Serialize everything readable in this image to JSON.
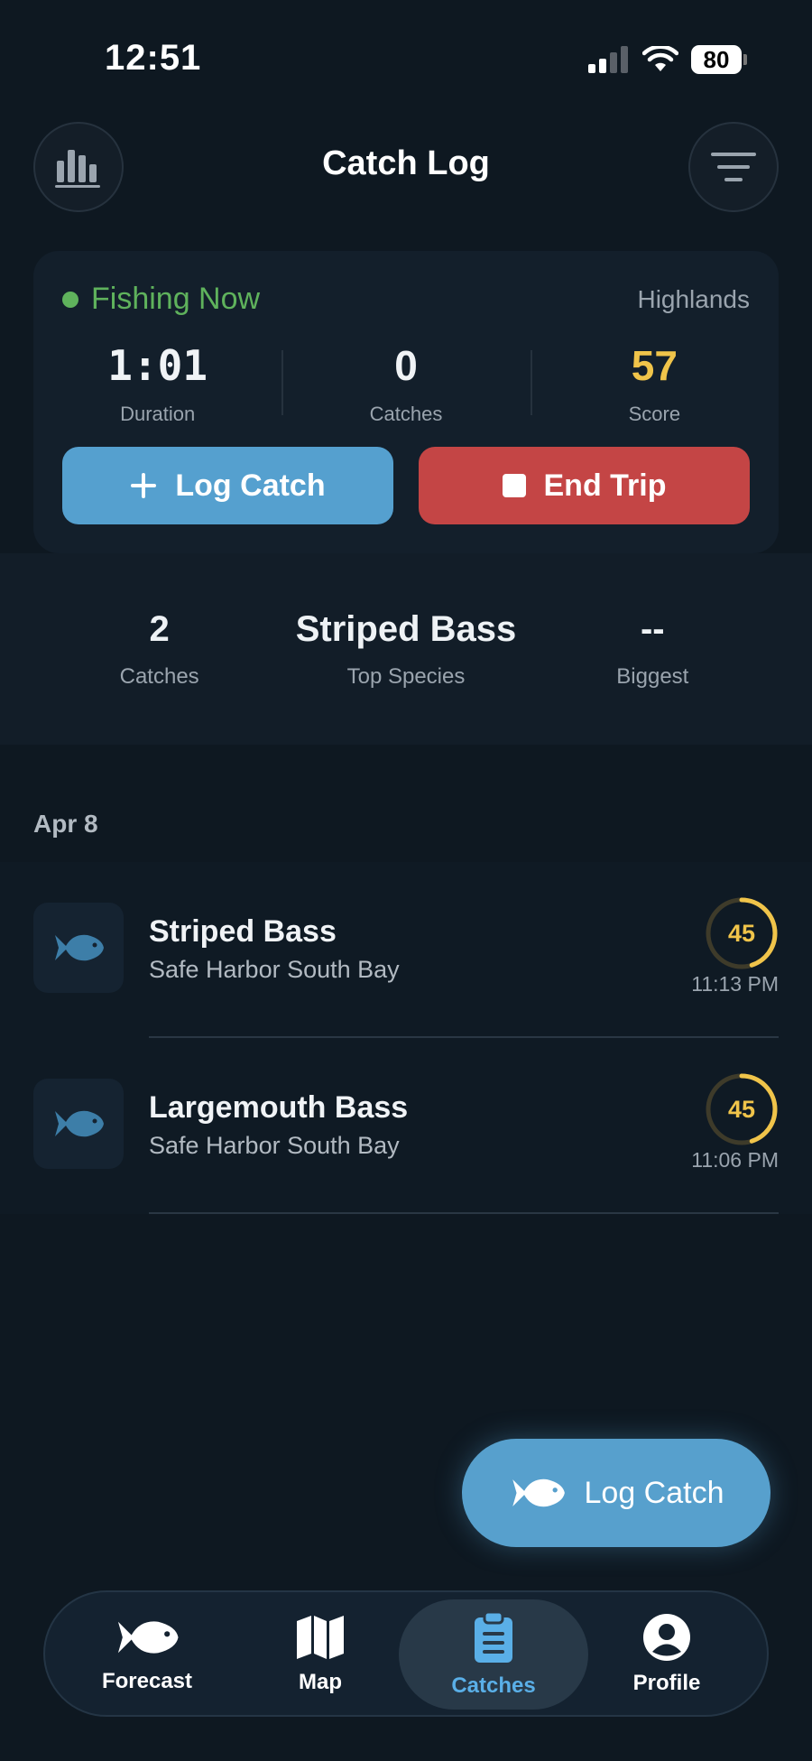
{
  "status_bar": {
    "time": "12:51",
    "battery": "80"
  },
  "header": {
    "title": "Catch Log"
  },
  "trip": {
    "status": "Fishing Now",
    "location": "Highlands",
    "stats": [
      {
        "value": "1:01",
        "label": "Duration"
      },
      {
        "value": "0",
        "label": "Catches"
      },
      {
        "value": "57",
        "label": "Score"
      }
    ],
    "log_catch_label": "Log Catch",
    "end_trip_label": "End Trip"
  },
  "summary": [
    {
      "value": "2",
      "label": "Catches"
    },
    {
      "value": "Striped Bass",
      "label": "Top Species"
    },
    {
      "value": "--",
      "label": "Biggest"
    }
  ],
  "date_header": "Apr 8",
  "catches": [
    {
      "species": "Striped Bass",
      "location": "Safe Harbor South Bay",
      "score": "45",
      "score_fraction": 0.45,
      "time": "11:13 PM"
    },
    {
      "species": "Largemouth Bass",
      "location": "Safe Harbor South Bay",
      "score": "45",
      "score_fraction": 0.45,
      "time": "11:06 PM"
    }
  ],
  "fab": {
    "label": "Log Catch"
  },
  "tabs": [
    {
      "label": "Forecast",
      "icon": "fish-icon"
    },
    {
      "label": "Map",
      "icon": "map-icon"
    },
    {
      "label": "Catches",
      "icon": "clipboard-icon",
      "active": true
    },
    {
      "label": "Profile",
      "icon": "profile-icon"
    }
  ],
  "colors": {
    "accent": "#55a0cf",
    "danger": "#c44545",
    "score": "#f0c44a",
    "live": "#5fb25c"
  }
}
